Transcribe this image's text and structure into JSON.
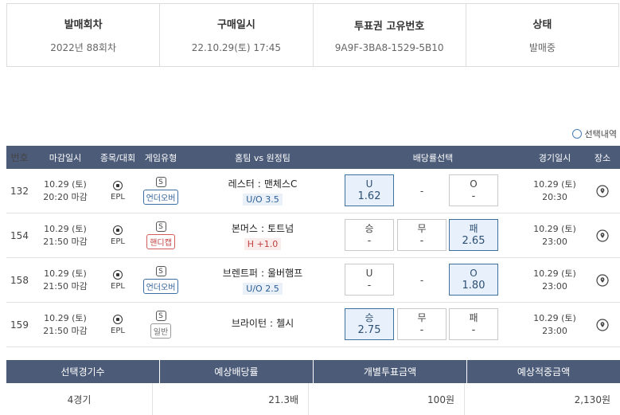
{
  "summary": {
    "round_label": "발매회차",
    "round_value": "2022년 88회차",
    "date_label": "구매일시",
    "date_value": "22.10.29(토) 17:45",
    "id_label": "투표권 고유번호",
    "id_value": "9A9F-3BA8-1529-5B10",
    "status_label": "상태",
    "status_value": "발매중"
  },
  "selection_toggle_label": "선택내역",
  "table": {
    "headers": [
      "번호",
      "마감일시",
      "종목/대회",
      "게임유형",
      "홈팀 vs 원정팀",
      "배당률선택",
      "경기일시",
      "장소"
    ],
    "rows": [
      {
        "no": "132",
        "deadline_date": "10.29 (토)",
        "deadline_time": "20:20 마감",
        "league": "EPL",
        "badge": "S",
        "type": "언더오버",
        "type_color": "blue",
        "home": "레스터",
        "sep": ":",
        "away": "맨체스C",
        "handicap": "U/O 3.5",
        "handicap_color": "blue",
        "odds": [
          {
            "label": "U",
            "value": "1.62",
            "selected": true
          },
          {
            "label": "-",
            "value": "",
            "selected": false
          },
          {
            "label": "O",
            "value": "-",
            "selected": false
          }
        ],
        "game_date": "10.29 (토)",
        "game_time": "20:30"
      },
      {
        "no": "154",
        "deadline_date": "10.29 (토)",
        "deadline_time": "21:50 마감",
        "league": "EPL",
        "badge": "S",
        "type": "핸디캡",
        "type_color": "red",
        "home": "본머스",
        "sep": ":",
        "away": "토트넘",
        "handicap": "H +1.0",
        "handicap_color": "red",
        "odds": [
          {
            "label": "승",
            "value": "-",
            "selected": false
          },
          {
            "label": "무",
            "value": "-",
            "selected": false
          },
          {
            "label": "패",
            "value": "2.65",
            "selected": true
          }
        ],
        "game_date": "10.29 (토)",
        "game_time": "23:00"
      },
      {
        "no": "158",
        "deadline_date": "10.29 (토)",
        "deadline_time": "21:50 마감",
        "league": "EPL",
        "badge": "S",
        "type": "언더오버",
        "type_color": "blue",
        "home": "브렌트퍼",
        "sep": ":",
        "away": "울버햄프",
        "handicap": "U/O 2.5",
        "handicap_color": "blue",
        "odds": [
          {
            "label": "U",
            "value": "-",
            "selected": false
          },
          {
            "label": "-",
            "value": "",
            "selected": false
          },
          {
            "label": "O",
            "value": "1.80",
            "selected": true
          }
        ],
        "game_date": "10.29 (토)",
        "game_time": "23:00"
      },
      {
        "no": "159",
        "deadline_date": "10.29 (토)",
        "deadline_time": "21:50 마감",
        "league": "EPL",
        "badge": "S",
        "type": "일반",
        "type_color": "gray",
        "home": "브라이턴",
        "sep": ":",
        "away": "첼시",
        "handicap": "",
        "handicap_color": "none",
        "odds": [
          {
            "label": "승",
            "value": "2.75",
            "selected": true
          },
          {
            "label": "무",
            "value": "-",
            "selected": false
          },
          {
            "label": "패",
            "value": "-",
            "selected": false
          }
        ],
        "game_date": "10.29 (토)",
        "game_time": "23:00"
      }
    ]
  },
  "footer": {
    "headers": [
      "선택경기수",
      "예상배당률",
      "개별투표금액",
      "예상적중금액"
    ],
    "values": [
      "4경기",
      "21.3배",
      "100원",
      "2,130원"
    ]
  },
  "colors": {
    "header_bg": "#4b5b78",
    "selected_border": "#3d6f9f",
    "selected_bg": "#e8f1fb"
  }
}
